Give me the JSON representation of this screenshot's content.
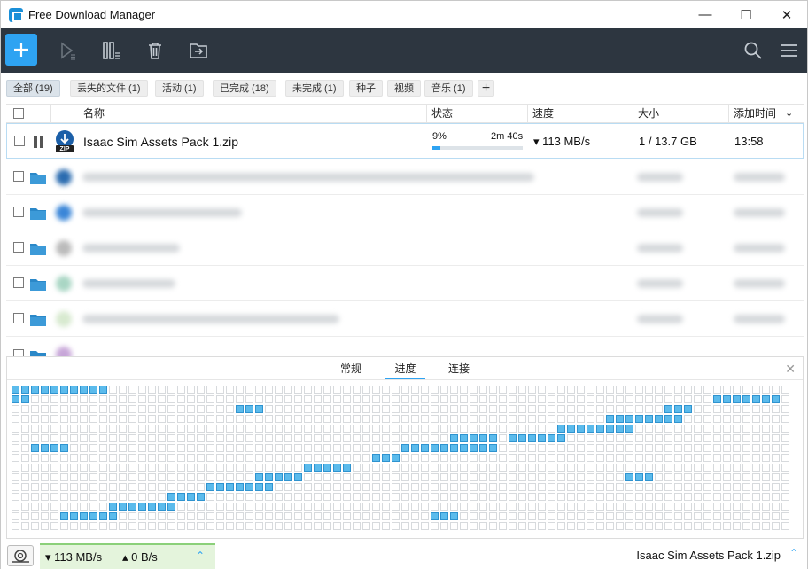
{
  "window": {
    "title": "Free Download Manager",
    "controls": {
      "minimize": "—",
      "maximize": "☐",
      "close": "✕"
    }
  },
  "toolbar": {
    "icons": [
      "plus-icon",
      "play-icon",
      "pause-all-icon",
      "trash-icon",
      "move-folder-icon",
      "search-icon",
      "menu-icon"
    ]
  },
  "filters": {
    "tabs": [
      {
        "label": "全部 (19)",
        "active": true
      },
      {
        "label": "丢失的文件 (1)"
      },
      {
        "label": "活动 (1)"
      },
      {
        "label": "已完成 (18)"
      },
      {
        "label": "未完成 (1)"
      },
      {
        "label": "种子"
      },
      {
        "label": "视频"
      },
      {
        "label": "音乐 (1)"
      }
    ],
    "add_label": "+"
  },
  "table": {
    "headers": {
      "name": "名称",
      "status": "状态",
      "speed": "速度",
      "size": "大小",
      "added": "添加时间"
    },
    "sort_indicator": "⌄",
    "active_row": {
      "file_name": "Isaac Sim Assets Pack 1.zip",
      "progress_label": "9%",
      "progress": 0.09,
      "eta": "2m 40s",
      "speed": "▾ 113 MB/s",
      "size": "1 / 13.7 GB",
      "added": "13:58",
      "file_type": "ZIP"
    }
  },
  "detail_panel": {
    "tabs": [
      {
        "label": "常规"
      },
      {
        "label": "进度",
        "active": true
      },
      {
        "label": "连接"
      }
    ],
    "close_label": "✕"
  },
  "statusbar": {
    "download_speed": "▾ 113 MB/s",
    "upload_speed": "▴ 0 B/s",
    "expand_label": "⌃",
    "current_file": "Isaac Sim Assets Pack 1.zip",
    "up_label": "⌃"
  },
  "colors": {
    "accent": "#2ea3f2",
    "toolbar": "#2d3640",
    "block_filled": "#5bbbec"
  }
}
